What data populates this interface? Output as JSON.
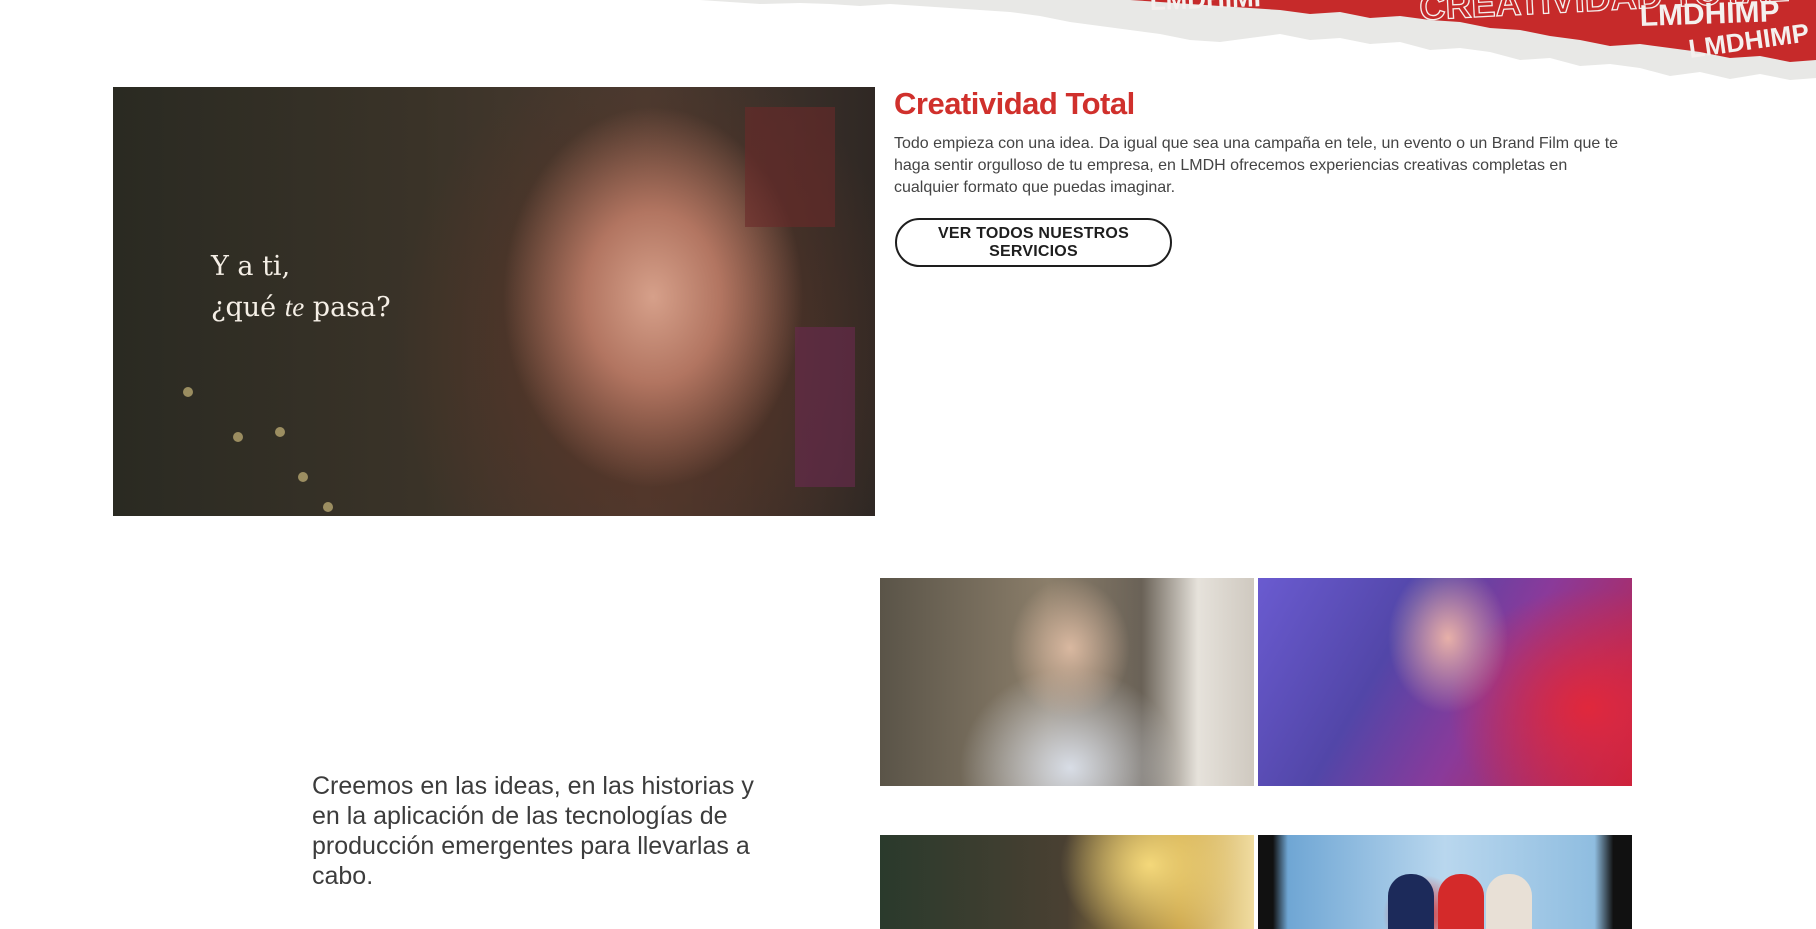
{
  "banner": {
    "strip_texts": [
      "LMDHIMP",
      "CREATIVIDAD TOTAL",
      "LMDHIMP",
      "LMDHIMP"
    ],
    "colors": {
      "strip": "#c62a2a",
      "paper": "#e8e8e6"
    }
  },
  "hero": {
    "caption_line1": "Y a ti,",
    "caption_line2_a": "¿qué ",
    "caption_line2_b": "te",
    "caption_line2_c": " pasa?"
  },
  "service": {
    "title": "Creatividad Total",
    "description": "Todo empieza con una idea. Da igual que sea una campaña en tele, un evento o un Brand Film que te haga sentir orgulloso de tu empresa, en LMDH ofrecemos experiencias creativas completas en cualquier formato que puedas imaginar.",
    "button_label": "VER TODOS NUESTROS SERVICIOS"
  },
  "belief": {
    "text": "Creemos en las ideas, en las historias y en la aplicación de las tecnologías de producción emergentes para llevarlas a cabo."
  },
  "colors": {
    "accent": "#d0302c",
    "text": "#444444",
    "button_border": "#1e1e1e"
  }
}
